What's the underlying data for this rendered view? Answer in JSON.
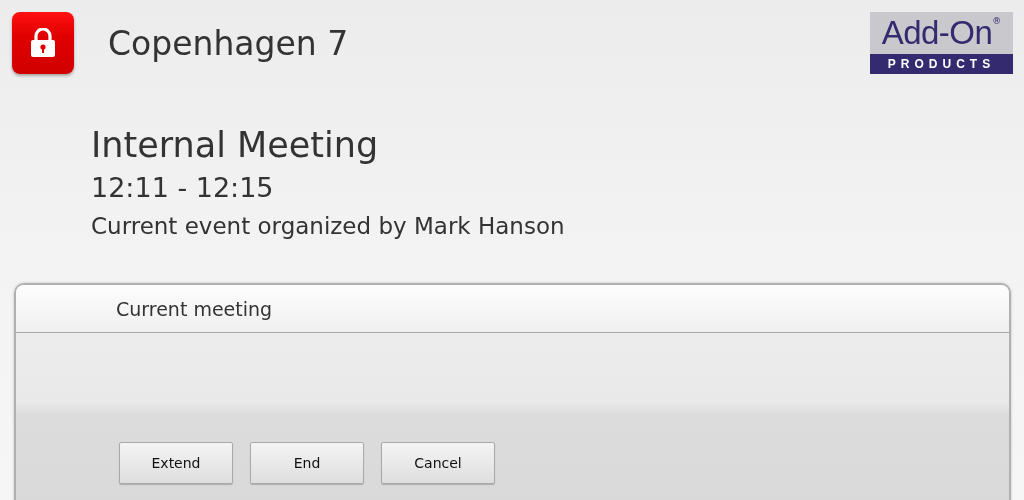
{
  "header": {
    "locked": true,
    "room": "Copenhagen 7",
    "logo": {
      "brand": "Add-On",
      "registered": "®",
      "tagline": "PRODUCTS"
    }
  },
  "event": {
    "title": "Internal Meeting",
    "time": "12:11 - 12:15",
    "organizer": "Current event organized by Mark Hanson"
  },
  "panel": {
    "title": "Current meeting",
    "buttons": [
      "Extend",
      "End",
      "Cancel"
    ]
  }
}
